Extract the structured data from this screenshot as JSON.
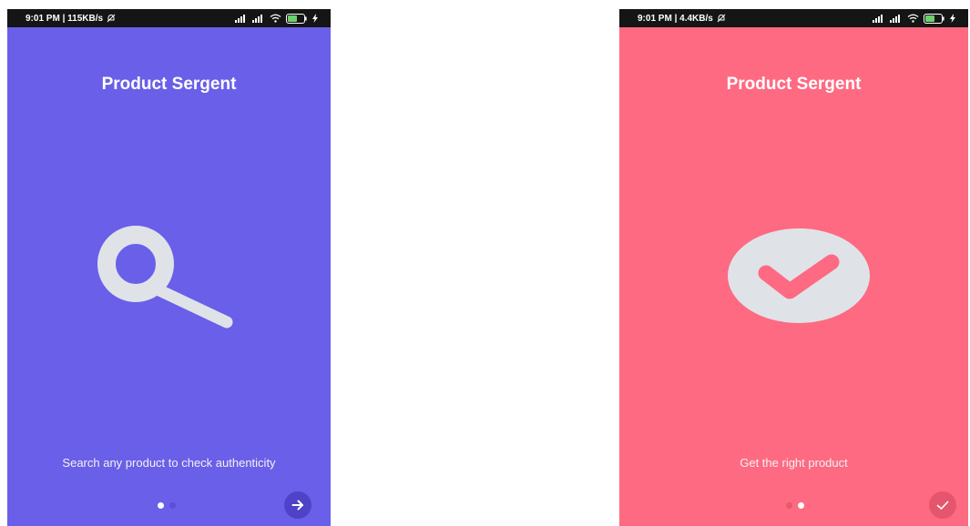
{
  "colors": {
    "screen1_bg": "#6a5fe8",
    "screen2_bg": "#fe6a81",
    "icon_fill": "#dfe3e8",
    "status_bar": "#151515"
  },
  "screens": [
    {
      "status": {
        "time_speed": "9:01 PM | 115KB/s",
        "battery": "39"
      },
      "title": "Product Sergent",
      "hero_icon": "magnifier-icon",
      "caption": "Search any product to check authenticity",
      "pager": {
        "active_index": 0,
        "count": 2
      },
      "action_icon": "arrow-right-icon"
    },
    {
      "status": {
        "time_speed": "9:01 PM | 4.4KB/s",
        "battery": "39"
      },
      "title": "Product Sergent",
      "hero_icon": "checkmark-circle-icon",
      "caption": "Get the right product",
      "pager": {
        "active_index": 1,
        "count": 2
      },
      "action_icon": "check-icon"
    }
  ]
}
